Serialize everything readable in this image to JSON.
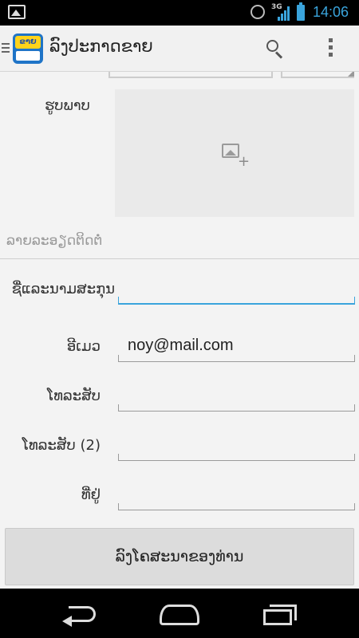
{
  "status_bar": {
    "notification_icon": "image-notification-icon",
    "network_type": "3G",
    "time": "14:06",
    "accent_color": "#3aa4dc"
  },
  "action_bar": {
    "up_icon": "menu-up-icon",
    "logo_text": "ຂາຍ",
    "title": "ລົງປະກາດຂາຍ",
    "search_icon": "search-icon",
    "overflow_icon": "overflow-menu-icon"
  },
  "form": {
    "photo_label": "ຮູບພາບ",
    "photo_add_icon": "add-image-icon",
    "section_header": "ລາຍລະອຽດຕິດຕໍ່",
    "fields": [
      {
        "label": "ຊື່ແລະນາມສະກຸນ",
        "value": "",
        "active": true
      },
      {
        "label": "ອີເມວ",
        "value": "noy@mail.com",
        "active": false
      },
      {
        "label": "ໂທລະສັບ",
        "value": "",
        "active": false
      },
      {
        "label": "ໂທລະສັບ (2)",
        "value": "",
        "active": false
      },
      {
        "label": "ທີ່ຢູ່",
        "value": "",
        "active": false
      }
    ],
    "submit_label": "ລົງໂຄສະນາຂອງທ່ານ"
  },
  "nav_bar": {
    "back_icon": "back-icon",
    "home_icon": "home-icon",
    "recents_icon": "recents-icon"
  }
}
